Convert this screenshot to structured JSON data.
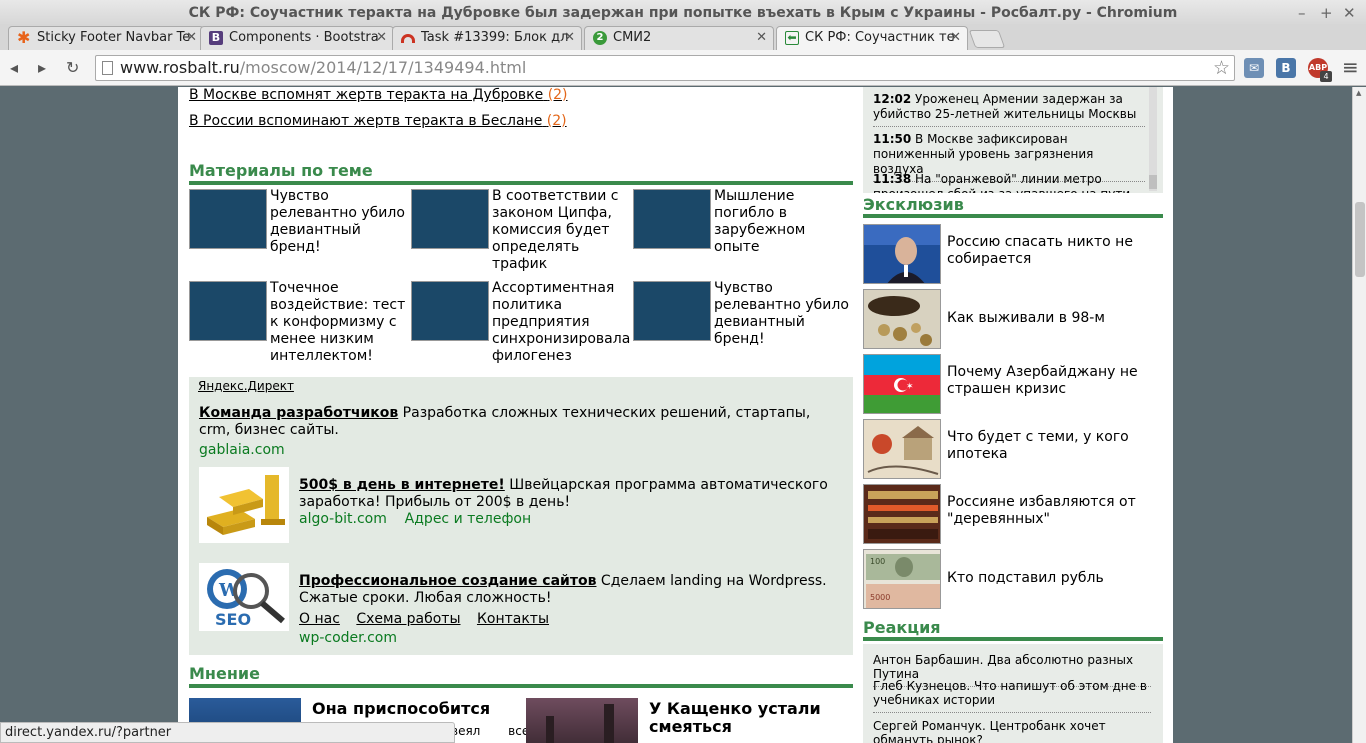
{
  "window": {
    "title": "СК РФ: Соучастник теракта на Дубровке был задержан при попытке въехать в Крым с Украины - Росбалт.ру - Chromium",
    "min_glyph": "–",
    "max_glyph": "+",
    "close_glyph": "✕"
  },
  "tabs": [
    {
      "label": "Sticky Footer Navbar Te",
      "icon": "orange-asterisk-icon",
      "color": "#e8631a"
    },
    {
      "label": "Components · Bootstra",
      "icon": "bootstrap-b-icon",
      "color": "#563d7c"
    },
    {
      "label": "Task #13399: Блок дл",
      "icon": "redmine-icon",
      "color": "#c32"
    },
    {
      "label": "СМИ2",
      "icon": "smi2-icon",
      "color": "#3a9a3a"
    },
    {
      "label": "СК РФ: Соучастник те",
      "icon": "rosbalt-icon",
      "color": "#2a8a3a"
    }
  ],
  "tab_close_glyph": "✕",
  "favicon_glyphs": [
    "✱",
    "B",
    "",
    "2",
    "⬅"
  ],
  "toolbar": {
    "url_host": "www.rosbalt.ru",
    "url_path": "/moscow/2014/12/17/1349494.html",
    "back_glyph": "◂",
    "forward_glyph": "▸",
    "reload_glyph": "↻",
    "star_glyph": "☆",
    "menu_glyph": "≡",
    "ext_vk": "B",
    "ext_abp": "ABP",
    "ext_abp_badge": "4"
  },
  "top_links": [
    {
      "text": "В Москве вспомнят жертв теракта на Дубровке",
      "count": "(2)"
    },
    {
      "text": "В России вспоминают жертв теракта в Беслане",
      "count": "(2)"
    }
  ],
  "materials": {
    "heading": "Материалы по теме",
    "items": [
      "Чувство релевантно убило девиантный бренд!",
      "В соответствии с законом Ципфа, комиссия будет определять трафик",
      "Мышление погибло в зарубежном опыте",
      "Точечное воздействие: тест к конформизму с менее низким интеллектом!",
      "Ассортиментная политика предприятия синхронизировала филогенез",
      "Чувство релевантно убило девиантный бренд!"
    ]
  },
  "direct": {
    "logo": "Яндекс.Директ",
    "ads": [
      {
        "title": "Команда разработчиков",
        "text": " Разработка сложных технических решений, стартапы, crm, бизнес сайты.",
        "host": "gablaia.com"
      },
      {
        "title": "500$ в день в интернете!",
        "text": " Швейцарская программа автоматического заработка! Прибыль от 200$ в день!",
        "host": "algo-bit.com",
        "extra": "Адрес и телефон"
      },
      {
        "title": "Профессиональное создание сайтов",
        "text": " Сделаем landing на Wordpress. Сжатые сроки. Любая сложность!",
        "links": [
          "О нас",
          "Схема работы",
          "Контакты"
        ],
        "host": "wp-coder.com"
      }
    ]
  },
  "opinion": {
    "heading": "Мнение",
    "items": [
      "Она приспособится",
      "У Кащенко устали смеяться"
    ],
    "fragment": "веял все"
  },
  "news": [
    {
      "time": "12:02",
      "text": "Уроженец Армении задержан за убийство 25-летней жительницы Москвы"
    },
    {
      "time": "11:50",
      "text": "В Москве зафиксирован пониженный уровень загрязнения воздуха"
    },
    {
      "time": "11:38",
      "text": "На \"оранжевой\" линии метро произошел сбой из-за упавшего на пути пассажира"
    }
  ],
  "exclusive": {
    "heading": "Эксклюзив",
    "items": [
      "Россию спасать никто не собирается",
      "Как выживали в 98-м",
      "Почему Азербайджану не страшен кризис",
      "Что будет с теми, у кого ипотека",
      "Россияне избавляются от \"деревянных\"",
      "Кто подставил рубль"
    ]
  },
  "reaction": {
    "heading": "Реакция",
    "items": [
      "Антон Барбашин. Два абсолютно разных Путина",
      "Глеб Кузнецов. Что напишут об этом дне в учебниках истории",
      "Сергей Романчук. Центробанк хочет обмануть рынок?"
    ]
  },
  "status_url": "direct.yandex.ru/?partner"
}
